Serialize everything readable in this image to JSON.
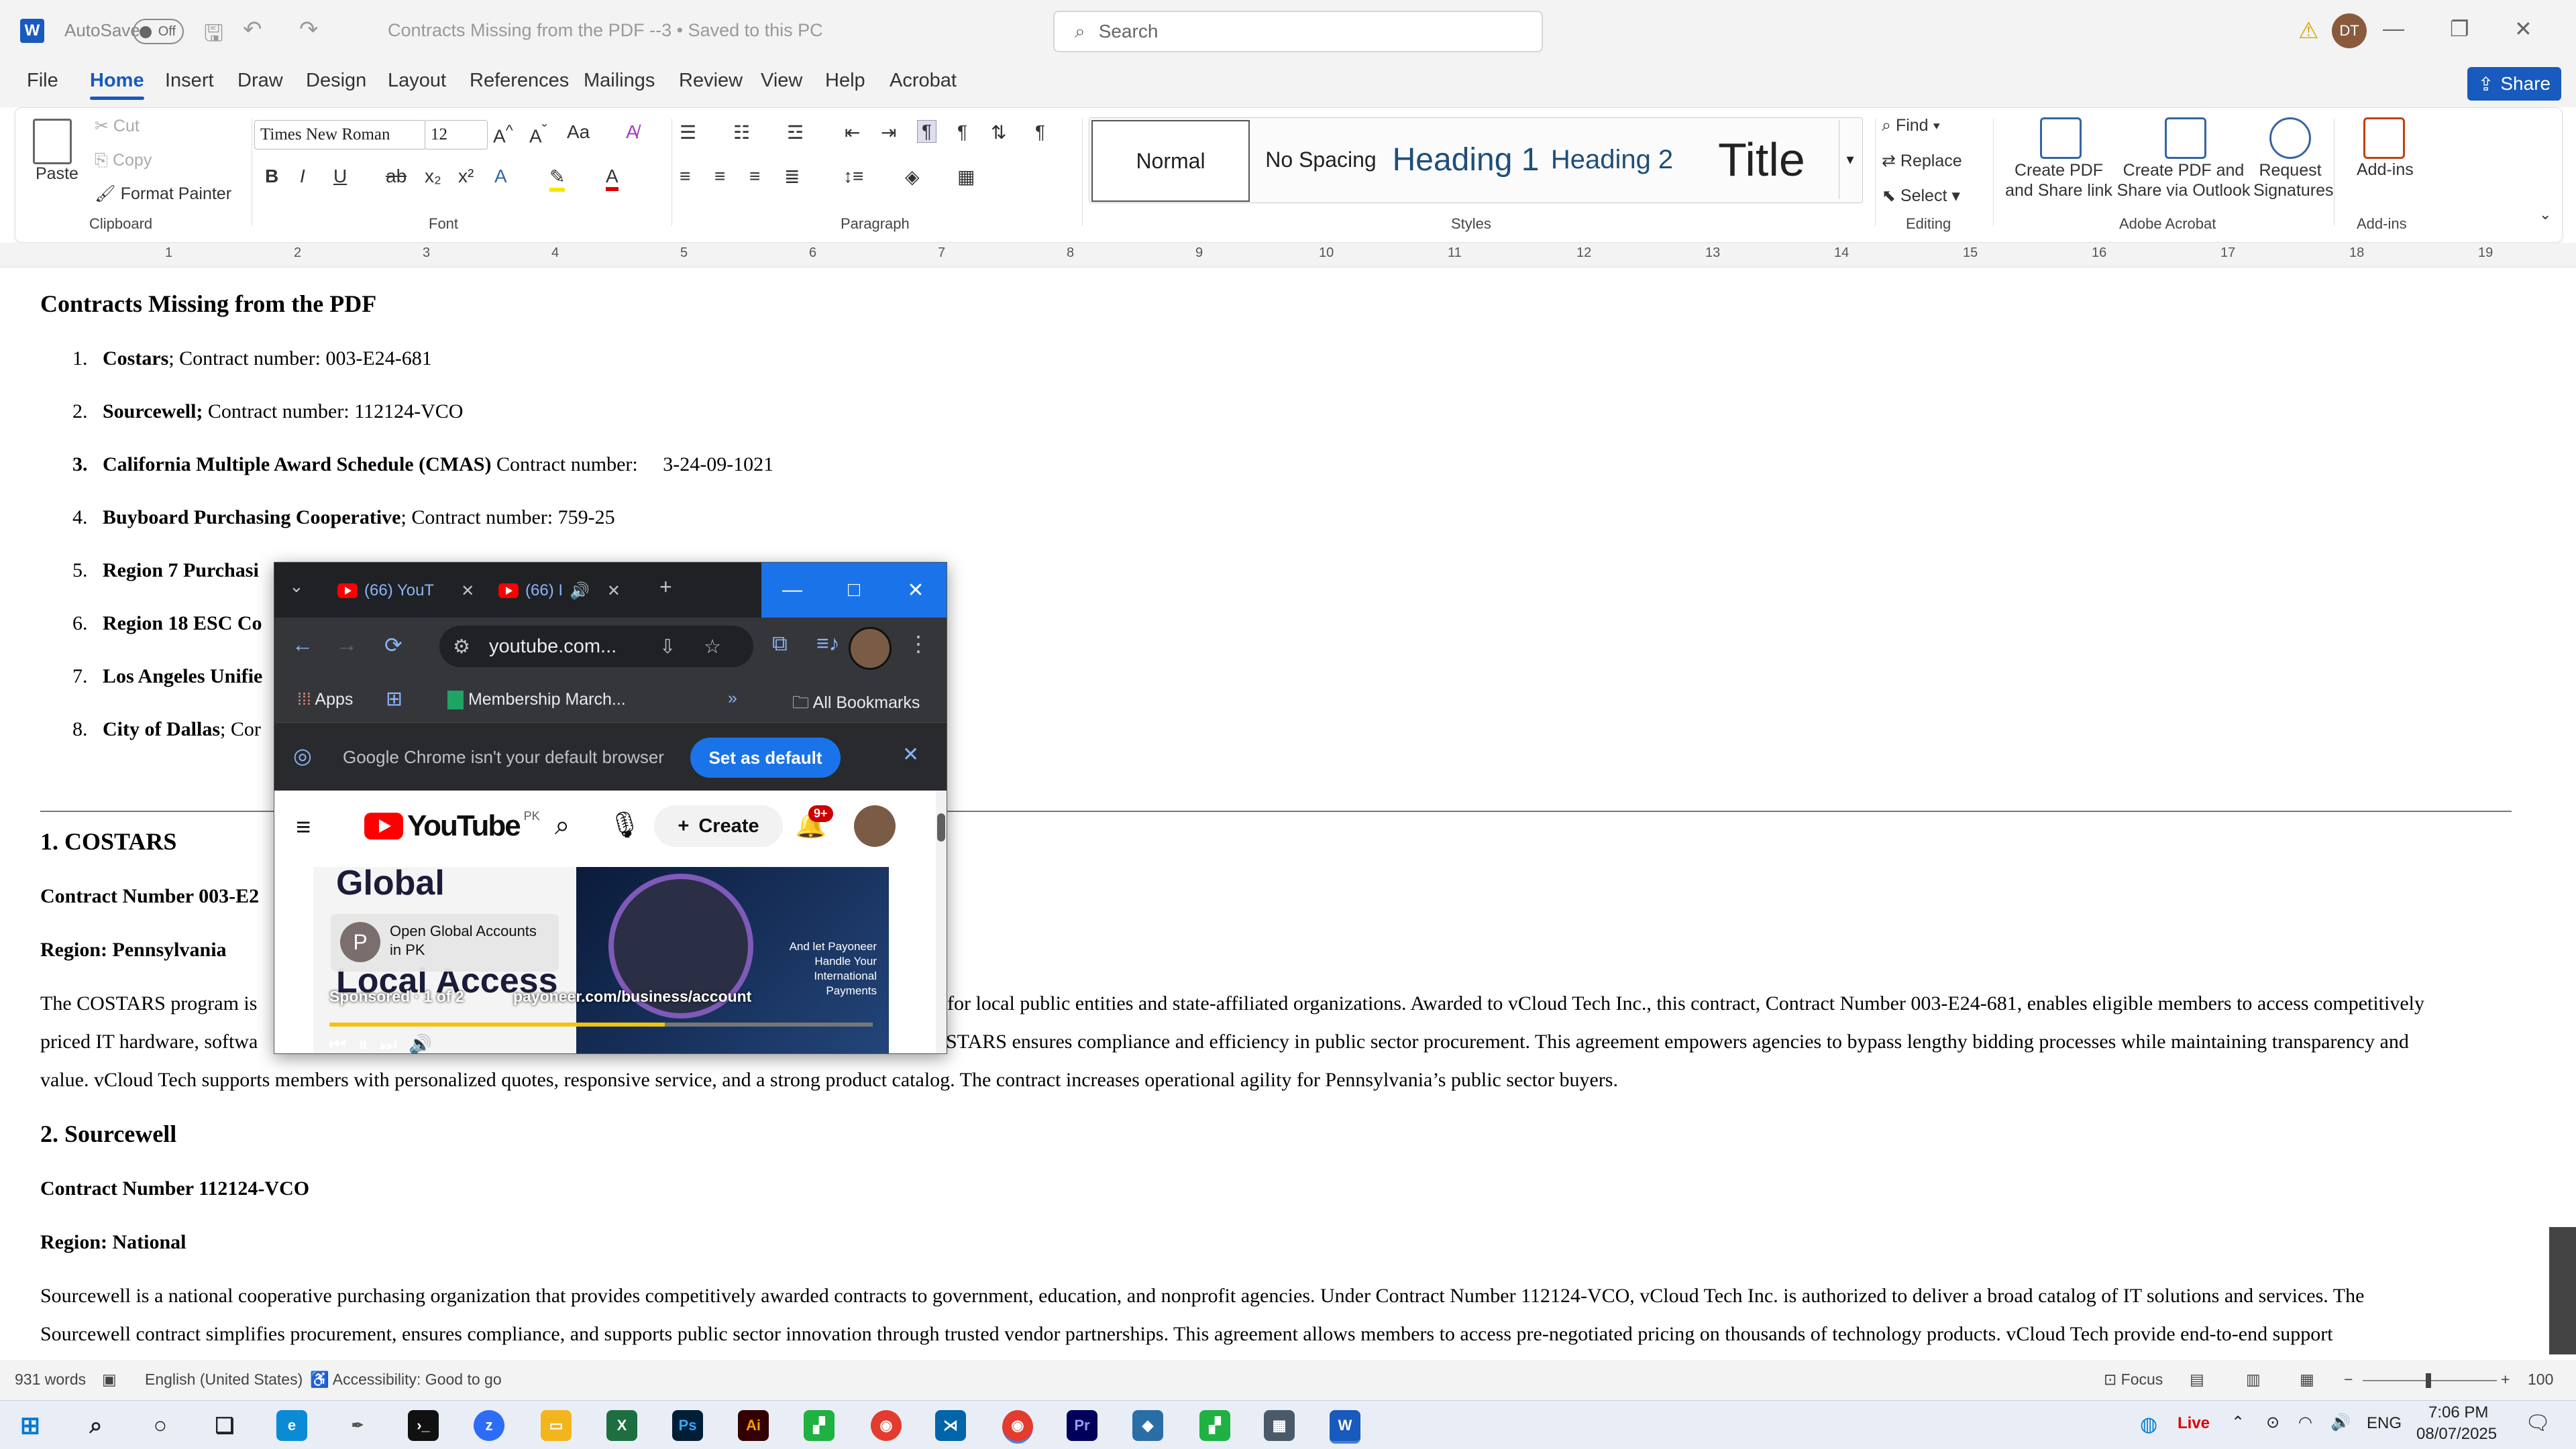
{
  "titlebar": {
    "autosave_label": "AutoSave",
    "autosave_state": "Off",
    "doc_title": "Contracts Missing from the PDF --3 • Saved to this PC",
    "search_placeholder": "Search",
    "user_initials": "DT"
  },
  "menu": {
    "items": [
      "File",
      "Home",
      "Insert",
      "Draw",
      "Design",
      "Layout",
      "References",
      "Mailings",
      "Review",
      "View",
      "Help",
      "Acrobat"
    ],
    "active": "Home",
    "share_label": "Share"
  },
  "ribbon": {
    "clipboard": {
      "paste": "Paste",
      "cut": "Cut",
      "copy": "Copy",
      "format_painter": "Format Painter",
      "label": "Clipboard"
    },
    "font": {
      "name": "Times New Roman",
      "size": "12",
      "label": "Font"
    },
    "paragraph": {
      "label": "Paragraph"
    },
    "styles": {
      "items": [
        "Normal",
        "No Spacing",
        "Heading 1",
        "Heading 2",
        "Title"
      ],
      "label": "Styles"
    },
    "editing": {
      "find": "Find",
      "replace": "Replace",
      "select": "Select",
      "label": "Editing"
    },
    "acrobat": {
      "create_share": "Create PDF and Share link",
      "create_outlook": "Create PDF and Share via Outlook",
      "request_sig": "Request Signatures",
      "label": "Adobe Acrobat"
    },
    "addins": {
      "addins": "Add-ins",
      "label": "Add-ins"
    }
  },
  "ruler": {
    "marks": [
      "1",
      "2",
      "3",
      "4",
      "5",
      "6",
      "7",
      "8",
      "9",
      "10",
      "11",
      "12",
      "13",
      "14",
      "15",
      "16",
      "17",
      "18",
      "19"
    ]
  },
  "document": {
    "heading": "Contracts Missing from the PDF",
    "list": [
      {
        "num": "1.",
        "bold": "Costars",
        "rest": "; Contract number: 003-E24-681"
      },
      {
        "num": "2.",
        "bold": "Sourcewell;",
        "rest": " Contract number: 112124-VCO"
      },
      {
        "num": "3.",
        "bold": "California Multiple Award Schedule (CMAS)",
        "rest": " Contract number:     3-24-09-1021"
      },
      {
        "num": "4.",
        "bold": "Buyboard Purchasing Cooperative",
        "rest": "; Contract number: 759-25"
      },
      {
        "num": "5.",
        "bold": "Region 7 Purchasi",
        "rest": ""
      },
      {
        "num": "6.",
        "bold": "Region 18 ESC Co",
        "rest": ""
      },
      {
        "num": "7.",
        "bold": "Los Angeles Unifie",
        "rest": ""
      },
      {
        "num": "8.",
        "bold": "City of Dallas",
        "rest": "; Cor"
      }
    ],
    "section1": {
      "title": "1.  COSTARS",
      "contract": "Contract Number 003-E2",
      "region": "Region: Pennsylvania",
      "para_line1_left": "The COSTARS program is",
      "para_line1_right": "for local public entities and state-affiliated organizations. Awarded to vCloud Tech Inc., this contract, Contract Number 003-E24-681, enables eligible members to access competitively",
      "para_line2_left": "priced IT hardware, softwa",
      "para_line2_right": "STARS ensures compliance and efficiency in public sector procurement. This agreement empowers agencies to bypass lengthy bidding processes while maintaining transparency and",
      "para_line3": "value. vCloud Tech supports members with personalized quotes, responsive service, and a strong product catalog. The contract increases operational agility for Pennsylvania’s public sector buyers."
    },
    "section2": {
      "title": "2.  Sourcewell",
      "contract": "Contract Number 112124-VCO",
      "region": "Region: National",
      "para_line1": "Sourcewell is a national cooperative purchasing organization that provides competitively awarded contracts to government, education, and nonprofit agencies. Under Contract Number 112124-VCO, vCloud Tech Inc. is authorized to deliver a broad catalog of IT solutions and services. The",
      "para_line2": "Sourcewell contract simplifies procurement, ensures compliance, and supports public sector innovation through trusted vendor partnerships. This agreement allows members to access pre-negotiated pricing on thousands of technology products. vCloud Tech provide end-to-end support"
    }
  },
  "statusbar": {
    "words": "931 words",
    "language": "English (United States)",
    "accessibility": "Accessibility: Good to go",
    "focus": "Focus",
    "zoom": "100"
  },
  "taskbar": {
    "live": "Live",
    "lang": "ENG",
    "time": "7:06 PM",
    "date": "08/07/2025"
  },
  "chrome": {
    "tab1": "(66) YouT",
    "tab2": "(66) I",
    "url": "youtube.com...",
    "bookmarks": {
      "apps": "Apps",
      "membership": "Membership March...",
      "all": "All Bookmarks"
    },
    "infobar": {
      "message": "Google Chrome isn't your default browser",
      "button": "Set as default"
    },
    "youtube": {
      "logo": "YouTube",
      "region": "PK",
      "create": "Create",
      "notifications": "9+",
      "ad_title_top": "Global",
      "ad_title_bottom": "Local Access",
      "ad_channel_initial": "P",
      "ad_channel_text": "Open Global Accounts in PK",
      "ad_sponsored": "Sponsored · 1 of 2",
      "ad_url": "payoneer.com/business/account",
      "ad_tagline": "And let Payoneer Handle Your International Payments"
    }
  },
  "colors": {
    "word_blue": "#185abd",
    "chrome_blue": "#1a73e8",
    "yt_red": "#ff0000"
  }
}
